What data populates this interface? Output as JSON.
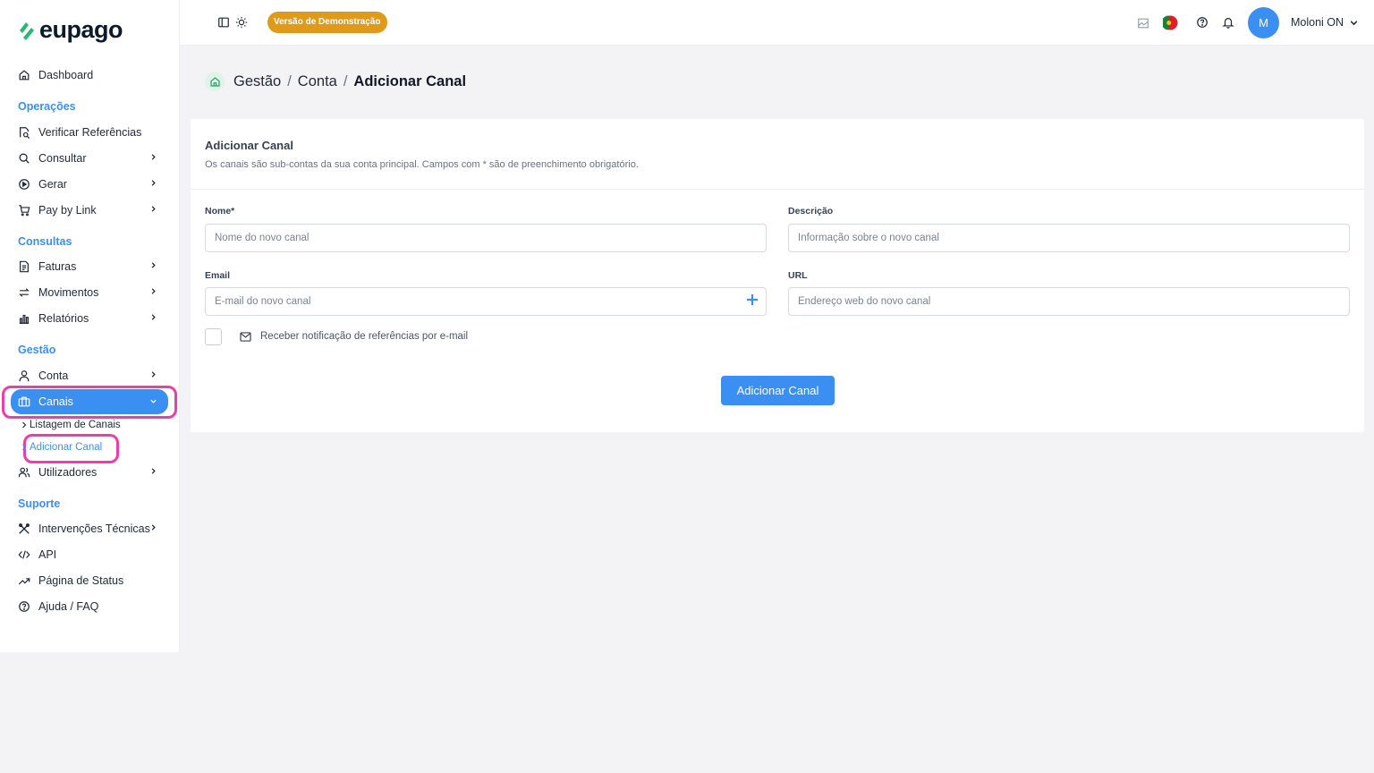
{
  "brand": {
    "name": "eupago",
    "accent": "#3b8ff3",
    "highlight": "#f03ca8"
  },
  "sidebar": {
    "dashboard": "Dashboard",
    "sections": {
      "operacoes": "Operações",
      "consultas": "Consultas",
      "gestao": "Gestão",
      "suporte": "Suporte"
    },
    "items": {
      "verificar": "Verificar Referências",
      "consultar": "Consultar",
      "gerar": "Gerar",
      "paybylink": "Pay by Link",
      "faturas": "Faturas",
      "movimentos": "Movimentos",
      "relatorios": "Relatórios",
      "conta": "Conta",
      "canais": "Canais",
      "utilizadores": "Utilizadores",
      "intervencoes": "Intervenções Técnicas",
      "api": "API",
      "status": "Página de Status",
      "ajuda": "Ajuda / FAQ"
    },
    "canais_sub": {
      "listagem": "Listagem de Canais",
      "adicionar": "Adicionar Canal"
    }
  },
  "topbar": {
    "demo_badge": "Versão de Demonstração",
    "avatar_initial": "M",
    "user_name": "Moloni ON"
  },
  "breadcrumb": [
    "Gestão",
    "Conta",
    "Adicionar Canal"
  ],
  "card": {
    "title": "Adicionar Canal",
    "subtitle": "Os canais são sub-contas da sua conta principal. Campos com *  são de preenchimento obrigatório.",
    "fields": {
      "nome": {
        "label": "Nome*",
        "placeholder": "Nome do novo canal",
        "value": ""
      },
      "descricao": {
        "label": "Descrição",
        "placeholder": "Informação sobre o novo canal",
        "value": ""
      },
      "email": {
        "label": "Email",
        "placeholder": "E-mail do novo canal",
        "value": ""
      },
      "url": {
        "label": "URL",
        "placeholder": "Endereço web do novo canal",
        "value": ""
      }
    },
    "notify_label": "Receber notificação de referências por e-mail",
    "notify_checked": false,
    "submit": "Adicionar Canal"
  }
}
